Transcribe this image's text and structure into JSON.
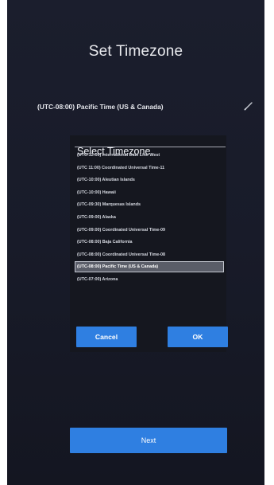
{
  "page": {
    "title": "Set Timezone"
  },
  "current_timezone": "(UTC-08:00) Pacific Time (US & Canada)",
  "icons": {
    "edit": "pencil-icon"
  },
  "dialog": {
    "title": "Select Timezone",
    "options": [
      "(UTC-12:00) International Date Line West",
      "(UTC 11:00) Coordinated Universal Time-11",
      "(UTC-10:00) Aleutian Islands",
      "(UTC-10:00) Hawaii",
      "(UTC-09:30) Marquesas Islands",
      "(UTC-09:00) Alaska",
      "(UTC-09:00) Coordinated Universal Time-09",
      "(UTC-08:00) Baja California",
      "(UTC-08:00) Coordinated Universal Time-08",
      "(UTC-08:00) Pacific Time (US & Canada)",
      "(UTC-07:00) Arizona"
    ],
    "selected_index": 9,
    "cancel_label": "Cancel",
    "ok_label": "OK"
  },
  "footer": {
    "next_label": "Next"
  },
  "colors": {
    "background": "#181b29",
    "accent": "#2f7fe1",
    "selected_row": "#5a5d68"
  }
}
